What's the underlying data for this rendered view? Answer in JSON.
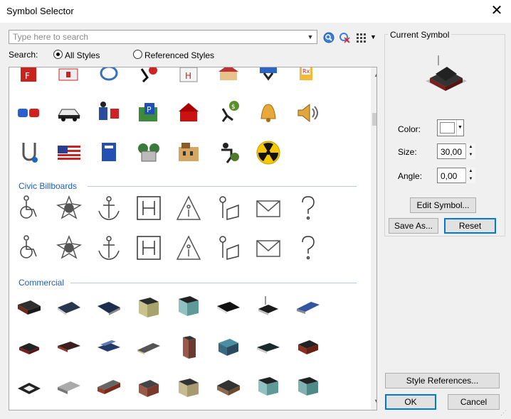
{
  "window": {
    "title": "Symbol Selector",
    "close_glyph": "✕"
  },
  "search": {
    "placeholder": "Type here to search",
    "value": ""
  },
  "search_mode": {
    "label": "Search:",
    "all_styles": "All Styles",
    "referenced_styles": "Referenced Styles",
    "selected": "all_styles"
  },
  "sections": [
    {
      "title": "Civic Billboards"
    },
    {
      "title": "Commercial"
    }
  ],
  "current_symbol": {
    "group_title": "Current Symbol",
    "color_label": "Color:",
    "color_value": "#ffffff",
    "size_label": "Size:",
    "size_value": "30,00",
    "angle_label": "Angle:",
    "angle_value": "0,00"
  },
  "buttons": {
    "edit_symbol": "Edit Symbol...",
    "save_as": "Save As...",
    "reset": "Reset",
    "style_references": "Style References...",
    "ok": "OK",
    "cancel": "Cancel"
  },
  "icons": {
    "toolbar": [
      "search-icon",
      "clear-search-icon",
      "view-grid-icon",
      "chevron-down-icon"
    ],
    "civic_row": [
      "fire-station-icon",
      "ambulance-icon",
      "caduceus-icon",
      "accident-icon",
      "hospital-icon",
      "home-icon",
      "fall-icon",
      "pharmacy-icon"
    ],
    "public_row": [
      "siren-icon",
      "police-car-icon",
      "police-officer-icon",
      "parking-icon",
      "school-icon",
      "thief-icon",
      "bell-icon",
      "speaker-icon"
    ],
    "public_row2": [
      "medical-icon",
      "us-flag-icon",
      "mailbox-icon",
      "cemetery-icon",
      "building-icon",
      "robbery-icon",
      "radiation-icon"
    ],
    "billboard_row": [
      "wheelchair-icon",
      "fire-dept-icon",
      "anchor-icon",
      "hospital-h-icon",
      "information-icon",
      "reading-icon",
      "mail-icon",
      "question-icon"
    ],
    "commercial_rows": [
      [
        "building-dark-icon",
        "building-flat-icon",
        "building-wide-icon",
        "building-tan-icon",
        "building-teal-icon",
        "building-black-icon",
        "building-antenna-icon",
        "building-blue-icon"
      ],
      [
        "building-red-icon",
        "building-brown-icon",
        "building-glass-icon",
        "building-low-icon",
        "tower-icon",
        "building-green-icon",
        "building-dark2-icon",
        "building-brick-icon"
      ],
      [
        "building-court-icon",
        "building-gray-icon",
        "building-long-icon",
        "building-block-icon",
        "building-beige-icon",
        "building-hip-icon",
        "building-teal2-icon",
        "building-teal3-icon"
      ]
    ]
  }
}
